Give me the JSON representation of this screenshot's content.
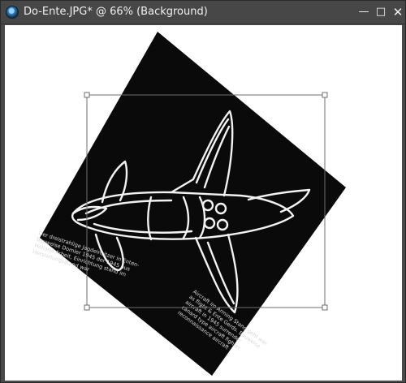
{
  "window": {
    "title": "Do-Ente.JPG* @  66% (Background)",
    "buttons": {
      "minimize": "—",
      "maximize": "□",
      "close": "✕"
    },
    "icon": "photoshop-document-icon"
  },
  "canvas": {
    "background_color": "#ffffff",
    "photo_color": "#0a0a0a",
    "caption_lines_left": [
      "Der dreistrahlige Jagdeinsitzer in Enten-",
      "bauweise Dornier 1945 der 1945 aus",
      "Holland Arbeit, Einrichtung stand im",
      "Herstellungsstand war"
    ],
    "caption_lines_right": [
      "Aircraft im Arming Stand geht war",
      "as flight & Ente Gerds. Bauweise",
      "aircraft in 1945 surrender",
      "canard type aircraft fighter",
      "reconnaissance aircraft"
    ]
  }
}
